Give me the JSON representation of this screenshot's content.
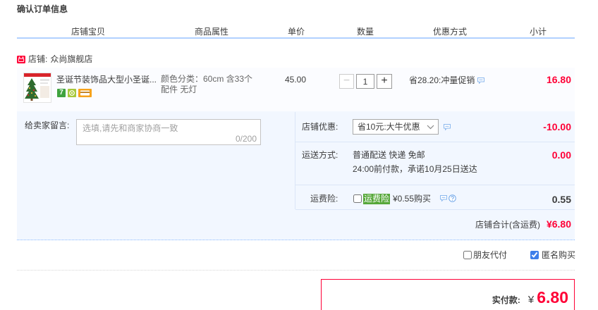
{
  "page_title": "确认订单信息",
  "columns": [
    "店铺宝贝",
    "商品属性",
    "单价",
    "数量",
    "优惠方式",
    "小计"
  ],
  "shop": {
    "icon": "tmall-shop-icon",
    "label": "店铺:",
    "name": "众尚旗舰店"
  },
  "item": {
    "title": "圣诞节装饰品大型小圣诞...",
    "badges": [
      {
        "icon": "seven-day-return-icon",
        "text": "7"
      },
      {
        "icon": "service-guarantee-icon"
      },
      {
        "icon": "credit-card-icon"
      }
    ],
    "attributes": "颜色分类：60cm 含33个配件 无灯",
    "price": "45.00",
    "stepper": {
      "minus": "−",
      "plus": "+"
    },
    "quantity": "1",
    "promotion": "省28.20:冲量促销",
    "promotion_icon": "chat-icon",
    "subtotal": "16.80"
  },
  "message": {
    "label": "给卖家留言:",
    "placeholder": "选填,请先和商家协商一致",
    "value": "",
    "counter": "0/200"
  },
  "shop_discount": {
    "label": "店铺优惠:",
    "selected": "省10元:大牛优惠",
    "icon": "chat-icon",
    "amount": "-10.00"
  },
  "shipping": {
    "label": "运送方式:",
    "method": "普通配送 快递 免邮",
    "promise": "24:00前付款，承诺10月25日送达",
    "amount": "0.00"
  },
  "insurance": {
    "label": "运费险:",
    "checked": false,
    "badge": "运费险",
    "price_text": "¥0.55购买",
    "icons": [
      "chat-icon",
      "help-icon"
    ],
    "amount": "0.55"
  },
  "shop_total": {
    "label": "店铺合计(含运费)",
    "amount": "¥6.80"
  },
  "options": [
    {
      "label": "朋友代付",
      "checked": false
    },
    {
      "label": "匿名购买",
      "checked": true
    }
  ],
  "payment": {
    "label": "实付款:",
    "currency": "¥",
    "amount": "6.80"
  },
  "colors": {
    "accent_red": "#ff0036",
    "header_line": "#b2d1ff",
    "item_bg": "#fbfcff",
    "ext_bg": "#f2f7ff",
    "dotted_blue": "#80b2ff",
    "checkbox_blue": "#3d7eea",
    "insurance_green": "#57a83b",
    "badge_green": "#3fa33f",
    "badge_lime": "#a8c83a",
    "badge_orange": "#f7a21b"
  }
}
